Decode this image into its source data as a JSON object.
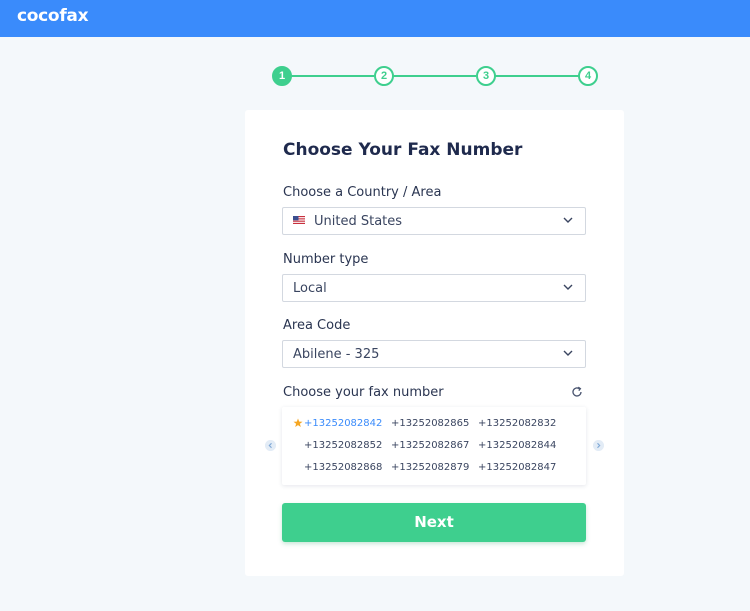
{
  "header": {
    "logo": "cocofax",
    "bg_color": "#3a8bfb"
  },
  "stepper": {
    "steps": [
      "1",
      "2",
      "3",
      "4"
    ],
    "active_step": 1,
    "color": "#3ecf8e"
  },
  "card": {
    "title": "Choose Your Fax Number",
    "country": {
      "label": "Choose a Country / Area",
      "value": "United States",
      "flag_icon": "us-flag-icon"
    },
    "number_type": {
      "label": "Number type",
      "value": "Local"
    },
    "area_code": {
      "label": "Area Code",
      "value": "Abilene - 325"
    },
    "fax_numbers": {
      "label": "Choose your fax number",
      "refresh_icon": "refresh-icon",
      "selected_index": 0,
      "items": [
        "+13252082842",
        "+13252082865",
        "+13252082832",
        "+13252082852",
        "+13252082867",
        "+13252082844",
        "+13252082868",
        "+13252082879",
        "+13252082847"
      ]
    },
    "next_label": "Next"
  }
}
